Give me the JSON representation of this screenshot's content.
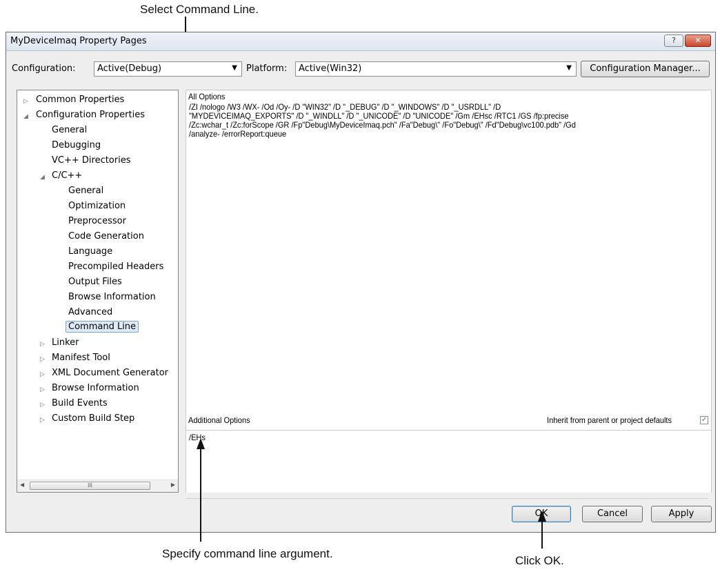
{
  "annotations": {
    "select": "Select Command Line.",
    "specify": "Specify command line argument.",
    "click": "Click OK."
  },
  "window": {
    "title": "MyDeviceImaq Property Pages",
    "help_glyph": "?",
    "close_glyph": "✕"
  },
  "toolbar": {
    "configuration_label": "Configuration:",
    "configuration_value": "Active(Debug)",
    "platform_label": "Platform:",
    "platform_value": "Active(Win32)",
    "config_manager_button": "Configuration Manager..."
  },
  "tree": {
    "items": [
      {
        "label": "Common Properties",
        "expander": "▷"
      },
      {
        "label": "Configuration Properties",
        "expander": "◢"
      },
      {
        "label": "General"
      },
      {
        "label": "Debugging"
      },
      {
        "label": "VC++ Directories"
      },
      {
        "label": "C/C++",
        "expander": "◢"
      },
      {
        "label": "General"
      },
      {
        "label": "Optimization"
      },
      {
        "label": "Preprocessor"
      },
      {
        "label": "Code Generation"
      },
      {
        "label": "Language"
      },
      {
        "label": "Precompiled Headers"
      },
      {
        "label": "Output Files"
      },
      {
        "label": "Browse Information"
      },
      {
        "label": "Advanced"
      },
      {
        "label": "Command Line",
        "selected": true
      },
      {
        "label": "Linker",
        "expander": "▷"
      },
      {
        "label": "Manifest Tool",
        "expander": "▷"
      },
      {
        "label": "XML Document Generator",
        "expander": "▷"
      },
      {
        "label": "Browse Information",
        "expander": "▷"
      },
      {
        "label": "Build Events",
        "expander": "▷"
      },
      {
        "label": "Custom Build Step",
        "expander": "▷"
      }
    ],
    "scroll_left": "◀",
    "scroll_right": "▶",
    "scroll_grip": "III"
  },
  "all_options": {
    "label": "All Options",
    "lines": [
      "/ZI /nologo /W3 /WX- /Od /Oy- /D \"WIN32\" /D \"_DEBUG\" /D \"_WINDOWS\" /D \"_USRDLL\" /D",
      "\"MYDEVICEIMAQ_EXPORTS\" /D \"_WINDLL\" /D \"_UNICODE\" /D \"UNICODE\" /Gm /EHsc /RTC1 /GS /fp:precise",
      "/Zc:wchar_t /Zc:forScope /GR /Fp\"Debug\\MyDeviceImaq.pch\" /Fa\"Debug\\\" /Fo\"Debug\\\" /Fd\"Debug\\vc100.pdb\" /Gd",
      "/analyze- /errorReport:queue"
    ]
  },
  "additional_options": {
    "label": "Additional Options",
    "value": "/EHs",
    "inherit_label": "Inherit from parent or project defaults",
    "inherit_checked": true,
    "check_glyph": "✓"
  },
  "buttons": {
    "ok": "OK",
    "cancel": "Cancel",
    "apply": "Apply"
  }
}
